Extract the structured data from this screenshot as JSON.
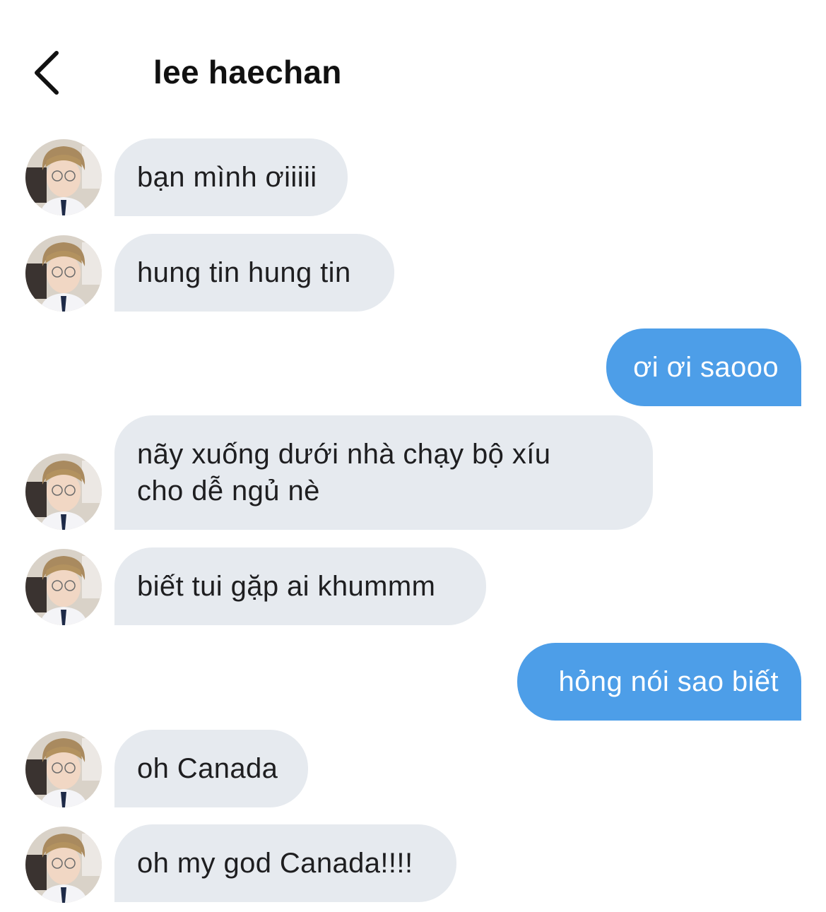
{
  "header": {
    "title": "lee haechan",
    "back_icon": "chevron-left-icon"
  },
  "colors": {
    "incoming_bubble": "#e6eaef",
    "outgoing_bubble": "#4d9ee8",
    "background": "#ffffff"
  },
  "messages": [
    {
      "direction": "incoming",
      "text": "bạn mình ơiiiii"
    },
    {
      "direction": "incoming",
      "text": "hung tin hung tin"
    },
    {
      "direction": "outgoing",
      "text": "ơi ơi saooo"
    },
    {
      "direction": "incoming",
      "text": "nãy xuống dưới nhà chạy bộ xíu cho dễ ngủ nè"
    },
    {
      "direction": "incoming",
      "text": "biết tui gặp ai khummm"
    },
    {
      "direction": "outgoing",
      "text": "hỏng nói sao biết"
    },
    {
      "direction": "incoming",
      "text": "oh Canada"
    },
    {
      "direction": "incoming",
      "text": "oh my god Canada!!!!"
    }
  ]
}
